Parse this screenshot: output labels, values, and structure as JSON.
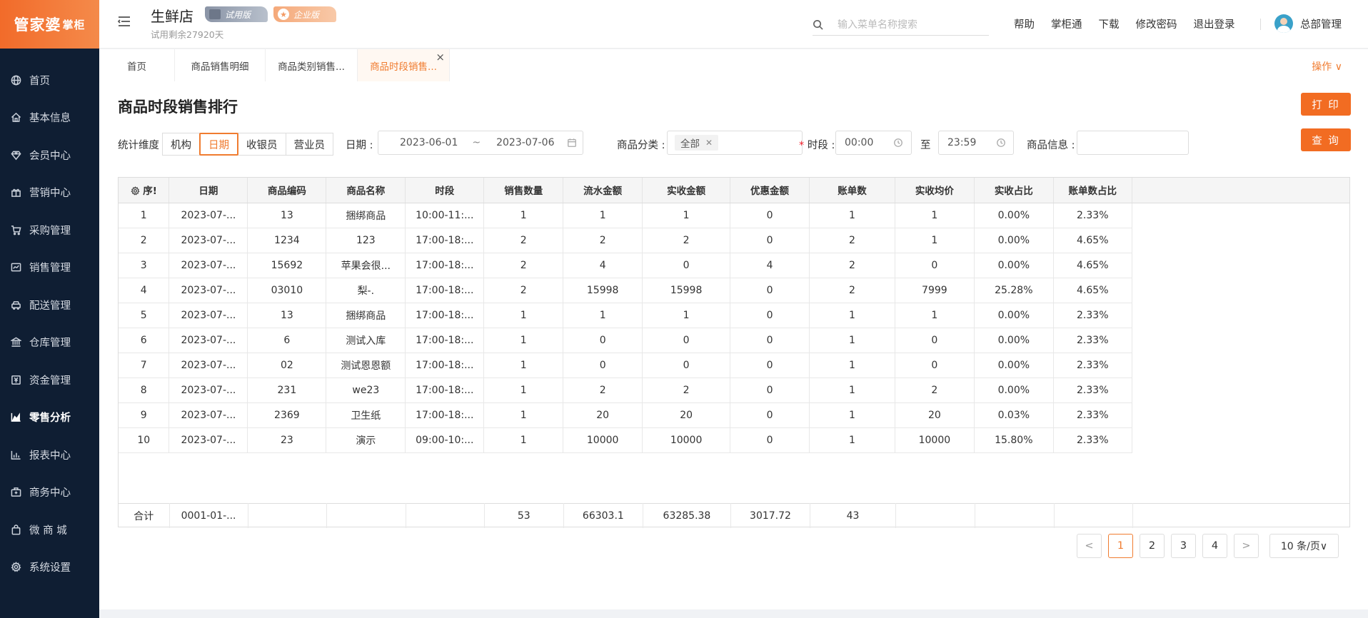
{
  "brand": {
    "logo_main": "管家婆",
    "logo_sub": "掌柜"
  },
  "sidebar": {
    "items": [
      {
        "label": "首页",
        "icon": "globe-icon"
      },
      {
        "label": "基本信息",
        "icon": "home-icon"
      },
      {
        "label": "会员中心",
        "icon": "diamond-icon"
      },
      {
        "label": "营销中心",
        "icon": "gift-icon"
      },
      {
        "label": "采购管理",
        "icon": "cart-icon"
      },
      {
        "label": "销售管理",
        "icon": "sales-icon"
      },
      {
        "label": "配送管理",
        "icon": "car-icon"
      },
      {
        "label": "仓库管理",
        "icon": "bank-icon"
      },
      {
        "label": "资金管理",
        "icon": "money-icon"
      },
      {
        "label": "零售分析",
        "icon": "area-chart-icon"
      },
      {
        "label": "报表中心",
        "icon": "bar-chart-icon"
      },
      {
        "label": "商务中心",
        "icon": "briefcase-icon"
      },
      {
        "label": "微 商 城",
        "icon": "shopping-bag-icon"
      },
      {
        "label": "系统设置",
        "icon": "gear-icon"
      }
    ],
    "active_index": 9
  },
  "header": {
    "store_name": "生鲜店",
    "trial_remaining": "试用剩余27920天",
    "badge_trial": "试用版",
    "badge_enterprise": "企业版",
    "search_placeholder": "输入菜单名称搜索",
    "links": [
      "帮助",
      "掌柜通",
      "下载",
      "修改密码",
      "退出登录"
    ],
    "user_name": "总部管理"
  },
  "tabs": {
    "items": [
      "首页",
      "商品销售明细",
      "商品类别销售...",
      "商品时段销售..."
    ],
    "active_index": 3,
    "ops_label": "操作 ∨"
  },
  "page": {
    "title": "商品时段销售排行",
    "print_label": "打 印",
    "query_label": "查 询"
  },
  "filters": {
    "dimension_label": "统计维度",
    "dimension_options": [
      "机构",
      "日期",
      "收银员",
      "营业员"
    ],
    "dimension_active": 1,
    "date_label": "日期 :",
    "date_start": "2023-06-01",
    "date_sep": "~",
    "date_end": "2023-07-06",
    "category_label": "商品分类 :",
    "category_value": "全部",
    "period_req": "*",
    "period_label": "时段 :",
    "period_start": "00:00",
    "period_to": "至",
    "period_end": "23:59",
    "goods_info_label": "商品信息 :",
    "goods_info_value": ""
  },
  "table": {
    "columns": [
      "序号",
      "日期",
      "商品编码",
      "商品名称",
      "时段",
      "销售数量",
      "流水金额",
      "实收金额",
      "优惠金额",
      "账单数",
      "实收均价",
      "实收占比",
      "账单数占比"
    ],
    "first_col_display": "序!",
    "rows": [
      [
        "1",
        "2023-07-...",
        "13",
        "捆绑商品",
        "10:00-11:...",
        "1",
        "1",
        "1",
        "0",
        "1",
        "1",
        "0.00%",
        "2.33%"
      ],
      [
        "2",
        "2023-07-...",
        "1234",
        "123",
        "17:00-18:...",
        "2",
        "2",
        "2",
        "0",
        "2",
        "1",
        "0.00%",
        "4.65%"
      ],
      [
        "3",
        "2023-07-...",
        "15692",
        "苹果会很...",
        "17:00-18:...",
        "2",
        "4",
        "0",
        "4",
        "2",
        "0",
        "0.00%",
        "4.65%"
      ],
      [
        "4",
        "2023-07-...",
        "03010",
        "梨-.",
        "17:00-18:...",
        "2",
        "15998",
        "15998",
        "0",
        "2",
        "7999",
        "25.28%",
        "4.65%"
      ],
      [
        "5",
        "2023-07-...",
        "13",
        "捆绑商品",
        "17:00-18:...",
        "1",
        "1",
        "1",
        "0",
        "1",
        "1",
        "0.00%",
        "2.33%"
      ],
      [
        "6",
        "2023-07-...",
        "6",
        "测试入库",
        "17:00-18:...",
        "1",
        "0",
        "0",
        "0",
        "1",
        "0",
        "0.00%",
        "2.33%"
      ],
      [
        "7",
        "2023-07-...",
        "02",
        "测试恩恩额",
        "17:00-18:...",
        "1",
        "0",
        "0",
        "0",
        "1",
        "0",
        "0.00%",
        "2.33%"
      ],
      [
        "8",
        "2023-07-...",
        "231",
        "we23",
        "17:00-18:...",
        "1",
        "2",
        "2",
        "0",
        "1",
        "2",
        "0.00%",
        "2.33%"
      ],
      [
        "9",
        "2023-07-...",
        "2369",
        "卫生纸",
        "17:00-18:...",
        "1",
        "20",
        "20",
        "0",
        "1",
        "20",
        "0.03%",
        "2.33%"
      ],
      [
        "10",
        "2023-07-...",
        "23",
        "演示",
        "09:00-10:...",
        "1",
        "10000",
        "10000",
        "0",
        "1",
        "10000",
        "15.80%",
        "2.33%"
      ]
    ],
    "totals": [
      "合计",
      "0001-01-...",
      "",
      "",
      "",
      "53",
      "66303.1",
      "63285.38",
      "3017.72",
      "43",
      "",
      "",
      ""
    ]
  },
  "pagination": {
    "prev": "<",
    "pages": [
      "1",
      "2",
      "3",
      "4"
    ],
    "active": "1",
    "next": ">",
    "page_size": "10 条/页∨"
  }
}
